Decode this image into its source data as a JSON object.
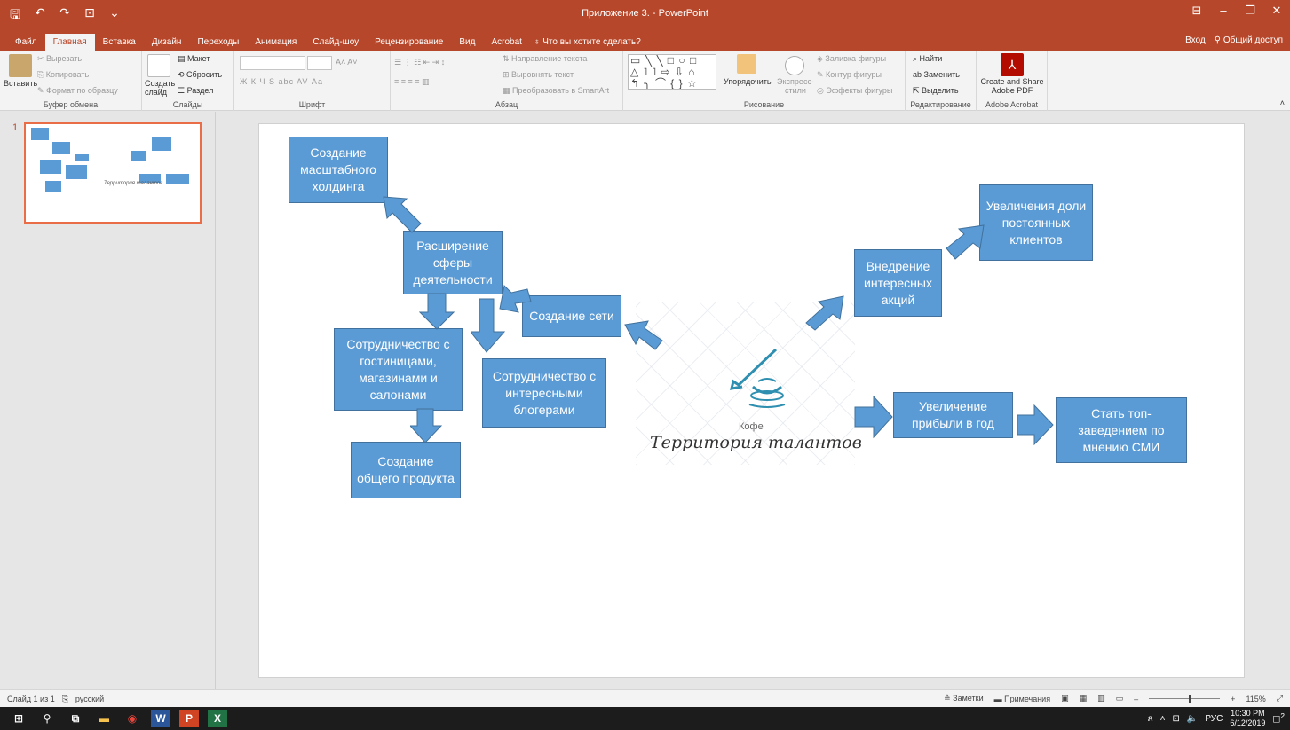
{
  "window": {
    "title": "Приложение 3. - PowerPoint",
    "qat_icons": [
      "save-icon",
      "undo-icon",
      "redo-icon",
      "present-icon",
      "customize-icon"
    ]
  },
  "tabs": [
    "Файл",
    "Главная",
    "Вставка",
    "Дизайн",
    "Переходы",
    "Анимация",
    "Слайд-шоу",
    "Рецензирование",
    "Вид",
    "Acrobat"
  ],
  "tell_me": "Что вы хотите сделать?",
  "account": {
    "signin": "Вход",
    "share": "Общий доступ"
  },
  "ribbon": {
    "clipboard": {
      "paste": "Вставить",
      "cut": "Вырезать",
      "copy": "Копировать",
      "format_painter": "Формат по образцу",
      "label": "Буфер обмена"
    },
    "slides": {
      "new_slide": "Создать слайд",
      "layout": "Макет",
      "reset": "Сбросить",
      "section": "Раздел",
      "label": "Слайды"
    },
    "font": {
      "label": "Шрифт",
      "buttons": "Ж  К  Ч  S  abc  AV  Аа"
    },
    "paragraph": {
      "text_direction": "Направление текста",
      "align_text": "Выровнять текст",
      "smartart": "Преобразовать в SmartArt",
      "label": "Абзац"
    },
    "drawing": {
      "arrange": "Упорядочить",
      "quick_styles": "Экспресс-стили",
      "fill": "Заливка фигуры",
      "outline": "Контур фигуры",
      "effects": "Эффекты фигуры",
      "label": "Рисование",
      "gallery": "▭ ╲ ╲ □ ○ □\n△ ˥ ˥ ⇨ ⇩ ⌂\n↰ ╮ ⌒ { } ☆"
    },
    "editing": {
      "find": "Найти",
      "replace": "Заменить",
      "select": "Выделить",
      "label": "Редактирование"
    },
    "acrobat": {
      "create_share": "Create and Share Adobe PDF",
      "label": "Adobe Acrobat"
    }
  },
  "thumbnail": {
    "number": "1"
  },
  "slide": {
    "boxes": [
      {
        "id": "holding",
        "text": "Создание масштабного холдинга"
      },
      {
        "id": "expand",
        "text": "Расширение сферы деятельности"
      },
      {
        "id": "network",
        "text": "Создание сети"
      },
      {
        "id": "hotels",
        "text": "Сотрудничество  с гостиницами, магазинами и салонами"
      },
      {
        "id": "bloggers",
        "text": "Сотрудничество с интересными блогерами"
      },
      {
        "id": "product",
        "text": "Создание общего продукта"
      },
      {
        "id": "promo",
        "text": "Внедрение интересных акций"
      },
      {
        "id": "clients",
        "text": "Увеличения доли постоянных клиентов"
      },
      {
        "id": "profit",
        "text": "Увеличение прибыли в год"
      },
      {
        "id": "top",
        "text": "Стать топ-заведением по мнению СМИ"
      }
    ],
    "logo": {
      "small": "Кофе",
      "script": "Территория талантов"
    }
  },
  "statusbar": {
    "slide_count": "Слайд 1 из 1",
    "language": "русский",
    "notes": "Заметки",
    "comments": "Примечания",
    "zoom": "115%",
    "zoom_level": 0.58
  },
  "taskbar": {
    "lang": "РУС",
    "time": "10:30 PM",
    "date": "6/12/2019",
    "notifications": "2"
  },
  "colors": {
    "accent": "#b7472a",
    "box": "#5b9bd5",
    "box_border": "#41719c"
  }
}
